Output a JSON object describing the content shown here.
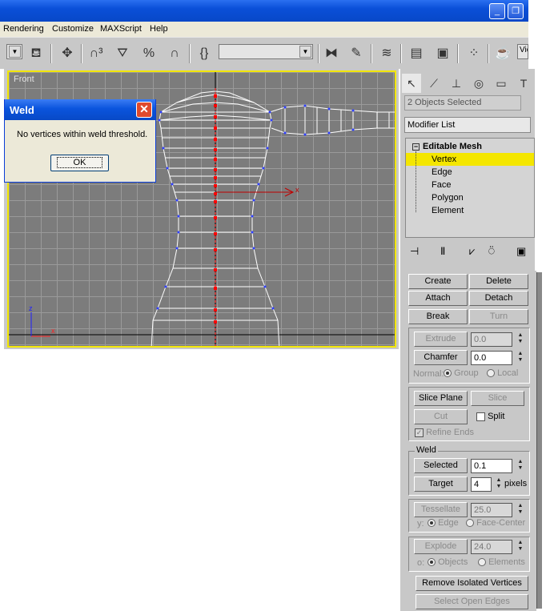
{
  "menu": [
    "Rendering",
    "Customize",
    "MAXScript",
    "Help"
  ],
  "toolbar": {
    "named_selection": "",
    "view_label": "Vie"
  },
  "viewport": {
    "label": "Front",
    "axis_x": "x",
    "axis_z": "z"
  },
  "dialog": {
    "title": "Weld",
    "message": "No vertices within weld threshold.",
    "ok_label": "OK"
  },
  "command_panel": {
    "objects_selected": "2 Objects Selected",
    "modifier_list": "Modifier List",
    "stack": {
      "root": "Editable Mesh",
      "items": [
        "Vertex",
        "Edge",
        "Face",
        "Polygon",
        "Element"
      ],
      "selected": "Vertex"
    }
  },
  "edit_geometry": {
    "create": "Create",
    "delete": "Delete",
    "attach": "Attach",
    "detach": "Detach",
    "break": "Break",
    "turn": "Turn",
    "extrude": "Extrude",
    "extrude_value": "0.0",
    "chamfer": "Chamfer",
    "chamfer_value": "0.0",
    "normal_label": "Normal:",
    "group": "Group",
    "local": "Local",
    "slice_plane": "Slice Plane",
    "slice": "Slice",
    "cut": "Cut",
    "split": "Split",
    "refine_ends": "Refine Ends",
    "weld_group": "Weld",
    "weld_selected": "Selected",
    "weld_selected_value": "0.1",
    "weld_target": "Target",
    "weld_target_value": "4",
    "pixels": "pixels",
    "tessellate": "Tessellate",
    "tessellate_value": "25.0",
    "by_prefix": "y:",
    "edge": "Edge",
    "face_center": "Face-Center",
    "explode": "Explode",
    "explode_value": "24.0",
    "to_prefix": "o:",
    "objects": "Objects",
    "elements": "Elements",
    "remove_isolated": "Remove Isolated Vertices",
    "select_open_edges": "Select Open Edges"
  }
}
